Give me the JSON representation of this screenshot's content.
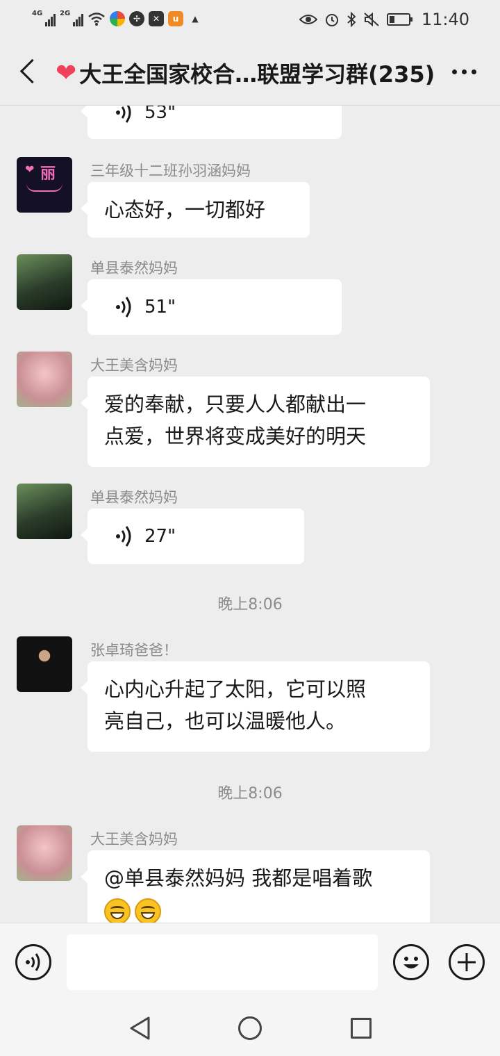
{
  "status_bar": {
    "net1": "4G",
    "net2": "2G",
    "time": "11:40",
    "battery_level": 0.25,
    "icons": [
      "signal-icon",
      "signal-icon",
      "wifi-icon",
      "app-icon",
      "app-icon",
      "app-icon",
      "app-icon",
      "app-icon",
      "eye-icon",
      "alarm-icon",
      "bluetooth-icon",
      "mute-icon",
      "battery-icon"
    ]
  },
  "header": {
    "title": "大王全国家校合…联盟学习群(235)",
    "heart_glyph": "❤"
  },
  "messages": [
    {
      "type": "voice",
      "sender": "",
      "duration": "53\""
    },
    {
      "type": "text",
      "sender": "三年级十二班孙羽涵妈妈",
      "text": "心态好，一切都好",
      "avatar_text": "丽"
    },
    {
      "type": "voice",
      "sender": "单县泰然妈妈",
      "duration": "51\""
    },
    {
      "type": "text",
      "sender": "大王美含妈妈",
      "lines": [
        "爱的奉献，只要人人都献出一",
        "点爱，世界将变成美好的明天"
      ]
    },
    {
      "type": "voice",
      "sender": "单县泰然妈妈",
      "duration": "27\""
    },
    {
      "type": "time",
      "text": "晚上8:06"
    },
    {
      "type": "text",
      "sender": "张卓琦爸爸！",
      "lines": [
        "心内心升起了太阳，它可以照",
        "亮自己，也可以温暖他人。"
      ]
    },
    {
      "type": "time",
      "text": "晚上8:06"
    },
    {
      "type": "text",
      "sender": "大王美含妈妈",
      "lines": [
        "@单县泰然妈妈  我都是唱着歌"
      ]
    }
  ],
  "input_bar": {
    "placeholder": ""
  },
  "colors": {
    "background": "#ededed",
    "bubble": "#ffffff",
    "heart": "#f0415a"
  }
}
